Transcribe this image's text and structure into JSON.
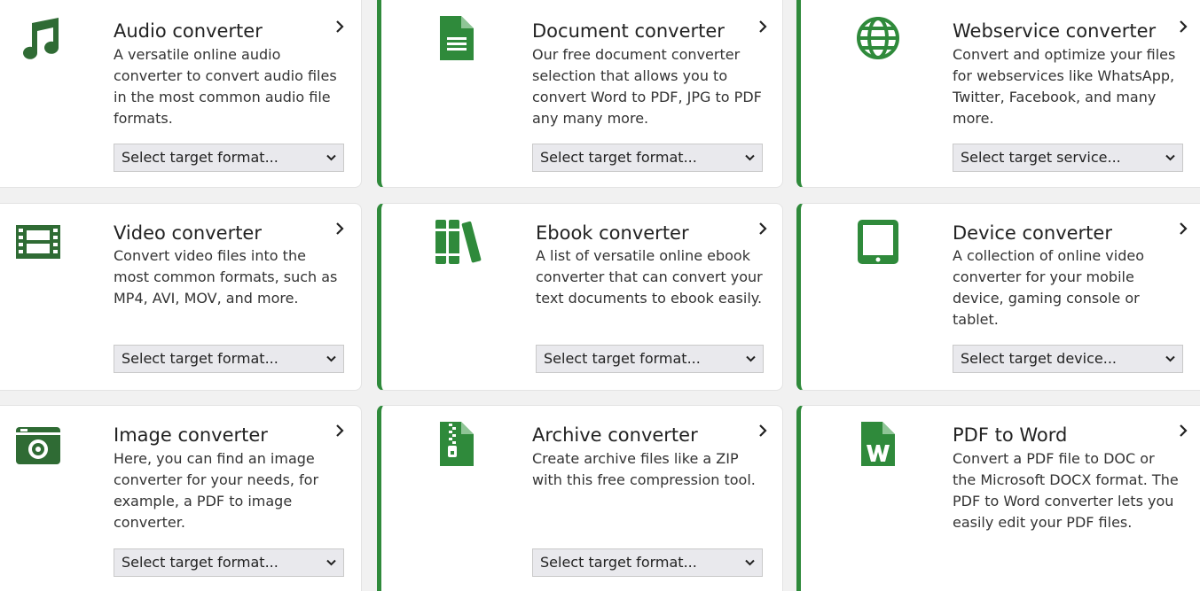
{
  "brand_color": "#2f8a3b",
  "cards": [
    {
      "title": "Audio converter",
      "icon": "music-note-icon",
      "description": "A versatile online audio converter to convert audio files in the most common audio file formats.",
      "select_value": "Select target format..."
    },
    {
      "title": "Document converter",
      "icon": "document-icon",
      "description": "Our free document converter selection that allows you to convert Word to PDF, JPG to PDF any many more.",
      "select_value": "Select target format..."
    },
    {
      "title": "Webservice converter",
      "icon": "globe-icon",
      "description": "Convert and optimize your files for webservices like WhatsApp, Twitter, Facebook, and many more.",
      "select_value": "Select target service..."
    },
    {
      "title": "Video converter",
      "icon": "film-icon",
      "description": "Convert video files into the most common formats, such as MP4, AVI, MOV, and more.",
      "select_value": "Select target format..."
    },
    {
      "title": "Ebook converter",
      "icon": "books-icon",
      "description": "A list of versatile online ebook converter that can convert your text documents to ebook easily.",
      "select_value": "Select target format..."
    },
    {
      "title": "Device converter",
      "icon": "tablet-icon",
      "description": "A collection of online video converter for your mobile device, gaming console or tablet.",
      "select_value": "Select target device..."
    },
    {
      "title": "Image converter",
      "icon": "camera-icon",
      "description": "Here, you can find an image converter for your needs, for example, a PDF to image converter.",
      "select_value": "Select target format..."
    },
    {
      "title": "Archive converter",
      "icon": "zip-file-icon",
      "description": "Create archive files like a ZIP with this free compression tool.",
      "select_value": "Select target format..."
    },
    {
      "title": "PDF to Word",
      "icon": "word-file-icon",
      "description": "Convert a PDF file to DOC or the Microsoft DOCX format. The PDF to Word converter lets you easily edit your PDF files."
    }
  ]
}
